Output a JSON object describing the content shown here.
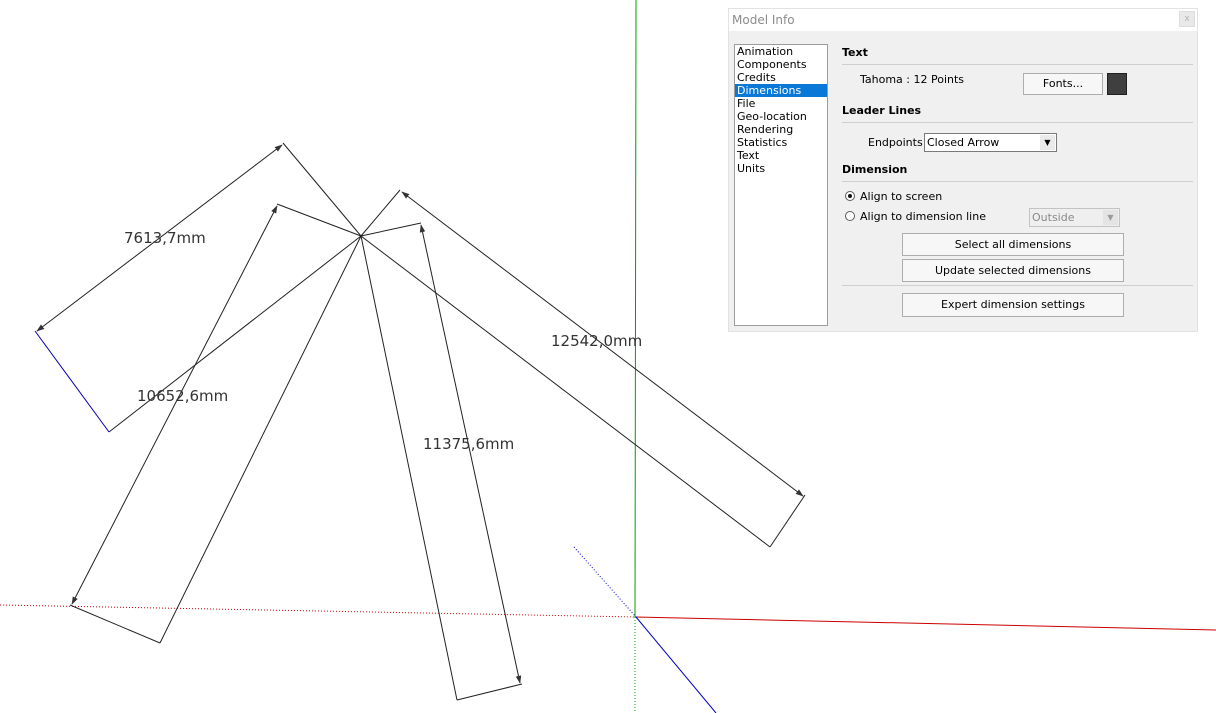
{
  "viewport": {
    "dimension_labels": [
      "7613,7mm",
      "10652,6mm",
      "11375,6mm",
      "12542,0mm"
    ],
    "axis_colors": {
      "red": "#cc0000",
      "green": "#009900",
      "blue": "#0000cc"
    }
  },
  "panel": {
    "title": "Model Info",
    "close_glyph": "x",
    "categories": [
      {
        "label": "Animation",
        "selected": false
      },
      {
        "label": "Components",
        "selected": false
      },
      {
        "label": "Credits",
        "selected": false
      },
      {
        "label": "Dimensions",
        "selected": true
      },
      {
        "label": "File",
        "selected": false
      },
      {
        "label": "Geo-location",
        "selected": false
      },
      {
        "label": "Rendering",
        "selected": false
      },
      {
        "label": "Statistics",
        "selected": false
      },
      {
        "label": "Text",
        "selected": false
      },
      {
        "label": "Units",
        "selected": false
      }
    ],
    "text_section": {
      "heading": "Text",
      "font_info": "Tahoma : 12 Points",
      "fonts_button": "Fonts...",
      "color": "#3f3f3f"
    },
    "leader_section": {
      "heading": "Leader Lines",
      "endpoints_label": "Endpoints:",
      "endpoints_value": "Closed Arrow"
    },
    "dimension_section": {
      "heading": "Dimension",
      "align_screen_label": "Align to screen",
      "align_screen_selected": true,
      "align_line_label": "Align to dimension line",
      "align_line_selected": false,
      "position_value": "Outside",
      "select_all_button": "Select all dimensions",
      "update_button": "Update selected dimensions",
      "expert_button": "Expert dimension settings"
    },
    "accent_color": "#0a78d7"
  }
}
